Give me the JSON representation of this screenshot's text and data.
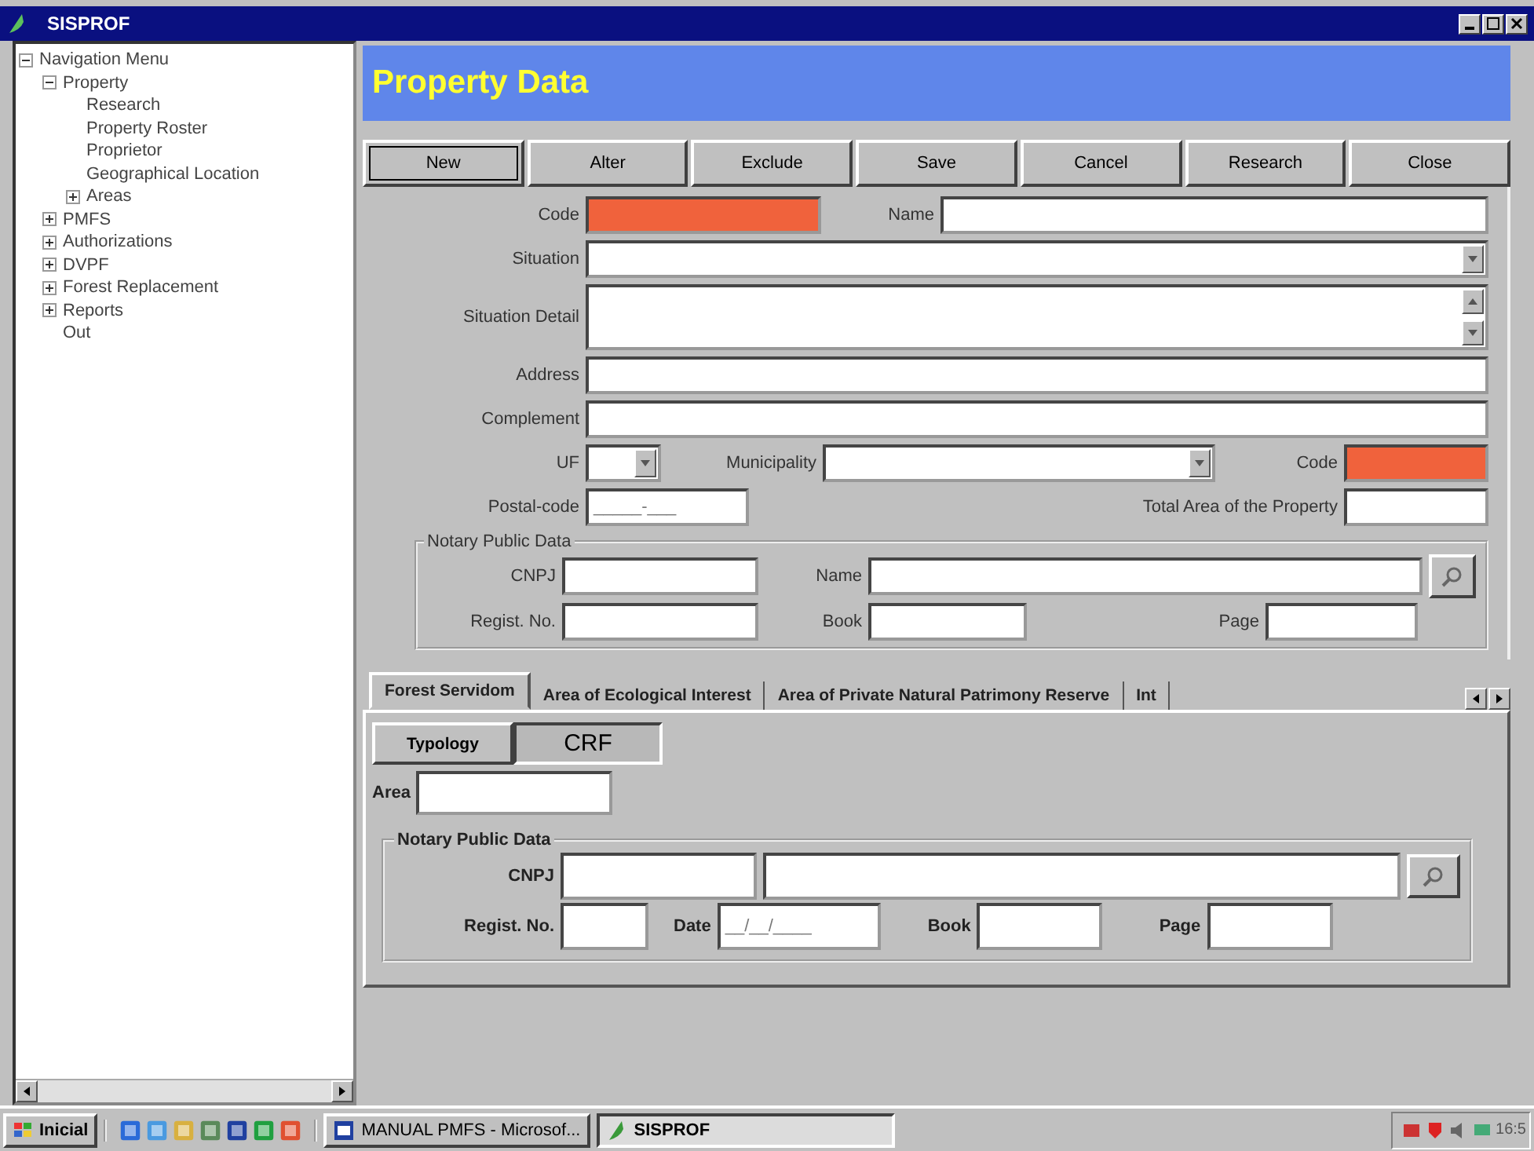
{
  "window": {
    "title": "SISPROF"
  },
  "nav_tree": {
    "items": [
      {
        "label": "Navigation Menu",
        "expanded": true,
        "children": [
          {
            "label": "Property",
            "expanded": true,
            "children": [
              {
                "label": "Research"
              },
              {
                "label": "Property Roster"
              },
              {
                "label": "Proprietor"
              },
              {
                "label": "Geographical Location"
              },
              {
                "label": "Areas",
                "expanded": false
              }
            ]
          },
          {
            "label": "PMFS",
            "expanded": false
          },
          {
            "label": "Authorizations",
            "expanded": false
          },
          {
            "label": "DVPF",
            "expanded": false
          },
          {
            "label": "Forest Replacement",
            "expanded": false
          },
          {
            "label": "Reports",
            "expanded": false
          },
          {
            "label": "Out"
          }
        ]
      }
    ]
  },
  "header": {
    "title": "Property Data"
  },
  "toolbar": [
    {
      "label": "New",
      "selected": true
    },
    {
      "label": "Alter",
      "selected": false
    },
    {
      "label": "Exclude",
      "selected": false
    },
    {
      "label": "Save",
      "selected": false
    },
    {
      "label": "Cancel",
      "selected": false
    },
    {
      "label": "Research",
      "selected": false
    },
    {
      "label": "Close",
      "selected": false
    }
  ],
  "property_form": {
    "code": {
      "label": "Code",
      "required": true
    },
    "name": {
      "label": "Name",
      "required": false
    },
    "situation": {
      "label": "Situation"
    },
    "situation_detail": {
      "label": "Situation Detail"
    },
    "address": {
      "label": "Address"
    },
    "complement": {
      "label": "Complement"
    },
    "uf": {
      "label": "UF"
    },
    "municipality": {
      "label": "Municipality"
    },
    "municipality_code": {
      "label": "Code",
      "required": true
    },
    "postal_code": {
      "label": "Postal-code",
      "value": "_____-___"
    },
    "total_area": {
      "label": "Total Area of the Property",
      "required": false
    },
    "notary": {
      "title": "Notary Public Data",
      "cnpj": {
        "label": "CNPJ"
      },
      "name": {
        "label": "Name"
      },
      "regist_no": {
        "label": "Regist. No."
      },
      "book": {
        "label": "Book"
      },
      "page": {
        "label": "Page"
      }
    }
  },
  "tabs": [
    {
      "label": "Forest Servidom",
      "selected": true
    },
    {
      "label": "Area of Ecological Interest",
      "selected": false
    },
    {
      "label": "Area of Private Natural Patrimony Reserve",
      "selected": false
    },
    {
      "label": "Int",
      "selected": false
    }
  ],
  "tab_panel": {
    "subtabs": [
      {
        "label": "Typology",
        "selected": false
      },
      {
        "label": "CRF",
        "selected": true
      }
    ],
    "area": {
      "label": "Area"
    },
    "notary": {
      "title": "Notary Public Data",
      "cnpj": {
        "label": "CNPJ"
      },
      "regist_no": {
        "label": "Regist. No."
      },
      "date": {
        "label": "Date",
        "value": "__/__/____"
      },
      "book": {
        "label": "Book"
      },
      "page": {
        "label": "Page"
      }
    }
  },
  "taskbar": {
    "start": "Inicial",
    "tasks": [
      {
        "label": "MANUAL PMFS - Microsof...",
        "selected": false
      },
      {
        "label": "SISPROF",
        "selected": true
      }
    ],
    "clock": "16:5"
  }
}
